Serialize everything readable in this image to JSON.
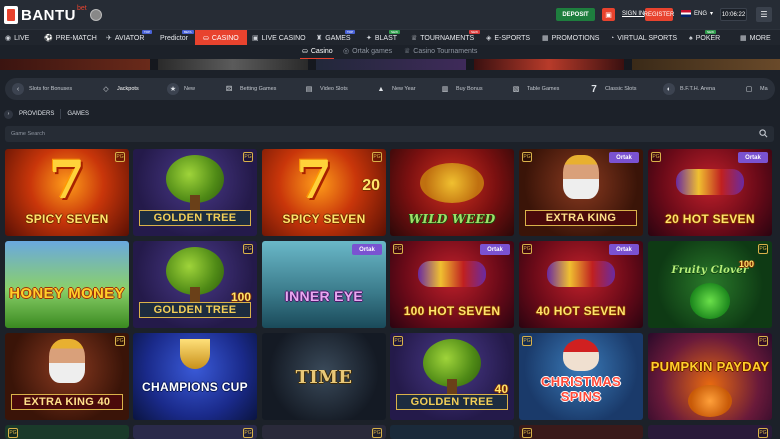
{
  "header": {
    "logo_text": "BANTU",
    "logo_sup": "bet",
    "deposit": "DEPOSIT",
    "signin": "SIGN IN",
    "register": "REGISTER",
    "language": "ENG",
    "time": "10:06:22"
  },
  "nav": {
    "items": [
      {
        "label": "LIVE",
        "icon": "live-icon"
      },
      {
        "label": "PRE-MATCH",
        "icon": "soccer-icon"
      },
      {
        "label": "AVIATOR",
        "icon": "plane-icon",
        "tag": "TOP"
      },
      {
        "label": "Predictor",
        "tag": "BETA"
      },
      {
        "label": "CASINO",
        "icon": "casino-chip-icon"
      },
      {
        "label": "LIVE CASINO",
        "icon": "live-casino-icon"
      },
      {
        "label": "GAMES",
        "icon": "games-icon",
        "tag": "TOP"
      },
      {
        "label": "BLAST",
        "icon": "rocket-icon",
        "tag": "NEW"
      },
      {
        "label": "TOURNAMENTS",
        "icon": "trophy-icon",
        "tag": "NEW"
      },
      {
        "label": "E-SPORTS",
        "icon": "gamepad-icon"
      },
      {
        "label": "PROMOTIONS",
        "icon": "gift-icon"
      },
      {
        "label": "VIRTUAL SPORTS",
        "icon": "virtual-icon"
      },
      {
        "label": "POKER",
        "icon": "poker-icon",
        "tag": "NEW"
      },
      {
        "label": "MORE",
        "icon": "grid-icon"
      }
    ]
  },
  "subtabs": [
    {
      "label": "Casino"
    },
    {
      "label": "Ortak games"
    },
    {
      "label": "Casino Tournaments"
    }
  ],
  "categories": [
    {
      "label": "Slots for Bonuses",
      "icon": "coins-icon"
    },
    {
      "label": "Jackpots",
      "icon": "diamond-icon"
    },
    {
      "label": "New",
      "icon": "star-icon"
    },
    {
      "label": "Betting Games",
      "icon": "dice-icon"
    },
    {
      "label": "Video Slots",
      "icon": "slot-icon"
    },
    {
      "label": "New Year",
      "icon": "tree-icon"
    },
    {
      "label": "Buy Bonus",
      "icon": "cart-icon"
    },
    {
      "label": "Table Games",
      "icon": "cards-icon"
    },
    {
      "label": "Classic Slots",
      "icon": "seven-icon"
    },
    {
      "label": "B.F.T.H. Arena",
      "icon": "arena-icon"
    },
    {
      "label": "Ma",
      "icon": "ma-icon"
    }
  ],
  "filters": {
    "providers": "PROVIDERS",
    "games": "GAMES"
  },
  "search": {
    "placeholder": "Game Search"
  },
  "badge_text": "Ortak",
  "games": [
    {
      "title": "SPICY SEVEN",
      "num": "",
      "ortak": false
    },
    {
      "title": "GOLDEN TREE",
      "num": "",
      "ortak": false
    },
    {
      "title": "SPICY SEVEN",
      "num": "20",
      "ortak": false
    },
    {
      "title": "WILD WEED",
      "num": "",
      "ortak": false
    },
    {
      "title": "EXTRA KING",
      "num": "",
      "ortak": true
    },
    {
      "title": "20 HOT SEVEN",
      "num": "",
      "ortak": true
    },
    {
      "title": "HONEY MONEY",
      "num": "",
      "ortak": false
    },
    {
      "title": "GOLDEN TREE",
      "num": "100",
      "ortak": false
    },
    {
      "title": "INNER EYE",
      "num": "",
      "ortak": true
    },
    {
      "title": "100 HOT SEVEN",
      "num": "",
      "ortak": true
    },
    {
      "title": "40 HOT SEVEN",
      "num": "",
      "ortak": true
    },
    {
      "title": "Fruity Clover",
      "num": "100",
      "ortak": false
    },
    {
      "title": "EXTRA KING 40",
      "num": "",
      "ortak": false
    },
    {
      "title": "CHAMPIONS CUP",
      "num": "",
      "ortak": false
    },
    {
      "title": "TIME",
      "num": "",
      "ortak": false
    },
    {
      "title": "GOLDEN TREE",
      "num": "40",
      "ortak": false
    },
    {
      "title": "CHRISTMAS SPINS",
      "num": "",
      "ortak": false
    },
    {
      "title": "PUMPKIN PAYDAY",
      "num": "",
      "ortak": false
    }
  ]
}
